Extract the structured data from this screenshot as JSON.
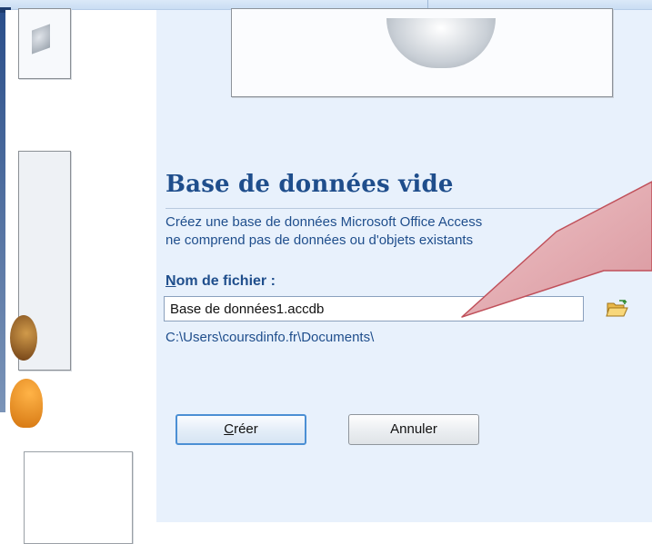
{
  "panel": {
    "title": "Base de données vide",
    "description_line1": "Créez une base de données Microsoft Office Access",
    "description_line2": "ne comprend pas de données ou d'objets existants",
    "filename_label_accel": "N",
    "filename_label_rest": "om de fichier :",
    "filename_value": "Base de données1.accdb",
    "path": "C:\\Users\\coursdinfo.fr\\Documents\\",
    "create_button_accel": "C",
    "create_button_rest": "réer",
    "cancel_button": "Annuler",
    "folder_icon": "folder-open-icon"
  },
  "colors": {
    "accent": "#1f4e8c",
    "pane_background": "#e8f1fc",
    "callout_fill": "#e6b3b8"
  }
}
